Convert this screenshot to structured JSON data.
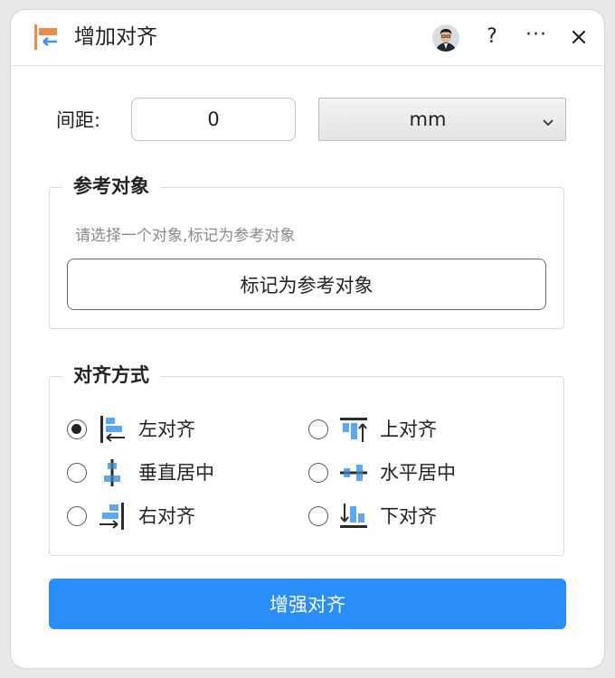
{
  "window": {
    "title": "增加对齐",
    "icons": {
      "app": "align-app-icon",
      "avatar": "user-avatar",
      "help": "help-icon",
      "more": "more-icon",
      "close": "close-icon"
    },
    "help_label": "?",
    "more_label": "···"
  },
  "spacing": {
    "label": "间距:",
    "value": "0",
    "unit": "mm"
  },
  "reference": {
    "title": "参考对象",
    "hint": "请选择一个对象,标记为参考对象",
    "button_label": "标记为参考对象"
  },
  "alignment": {
    "title": "对齐方式",
    "selected": "left",
    "options": [
      {
        "id": "left",
        "label": "左对齐",
        "icon": "align-left-icon",
        "checked": true
      },
      {
        "id": "top",
        "label": "上对齐",
        "icon": "align-top-icon",
        "checked": false
      },
      {
        "id": "vcenter",
        "label": "垂直居中",
        "icon": "align-vertical-center-icon",
        "checked": false
      },
      {
        "id": "hcenter",
        "label": "水平居中",
        "icon": "align-horizontal-center-icon",
        "checked": false
      },
      {
        "id": "right",
        "label": "右对齐",
        "icon": "align-right-icon",
        "checked": false
      },
      {
        "id": "bottom",
        "label": "下对齐",
        "icon": "align-bottom-icon",
        "checked": false
      }
    ]
  },
  "actions": {
    "enhance_label": "增强对齐"
  },
  "colors": {
    "primary": "#2a8ef8",
    "icon_blue": "#5aa9ef",
    "icon_dark": "#2b2b2b",
    "icon_orange": "#f08a4b"
  }
}
